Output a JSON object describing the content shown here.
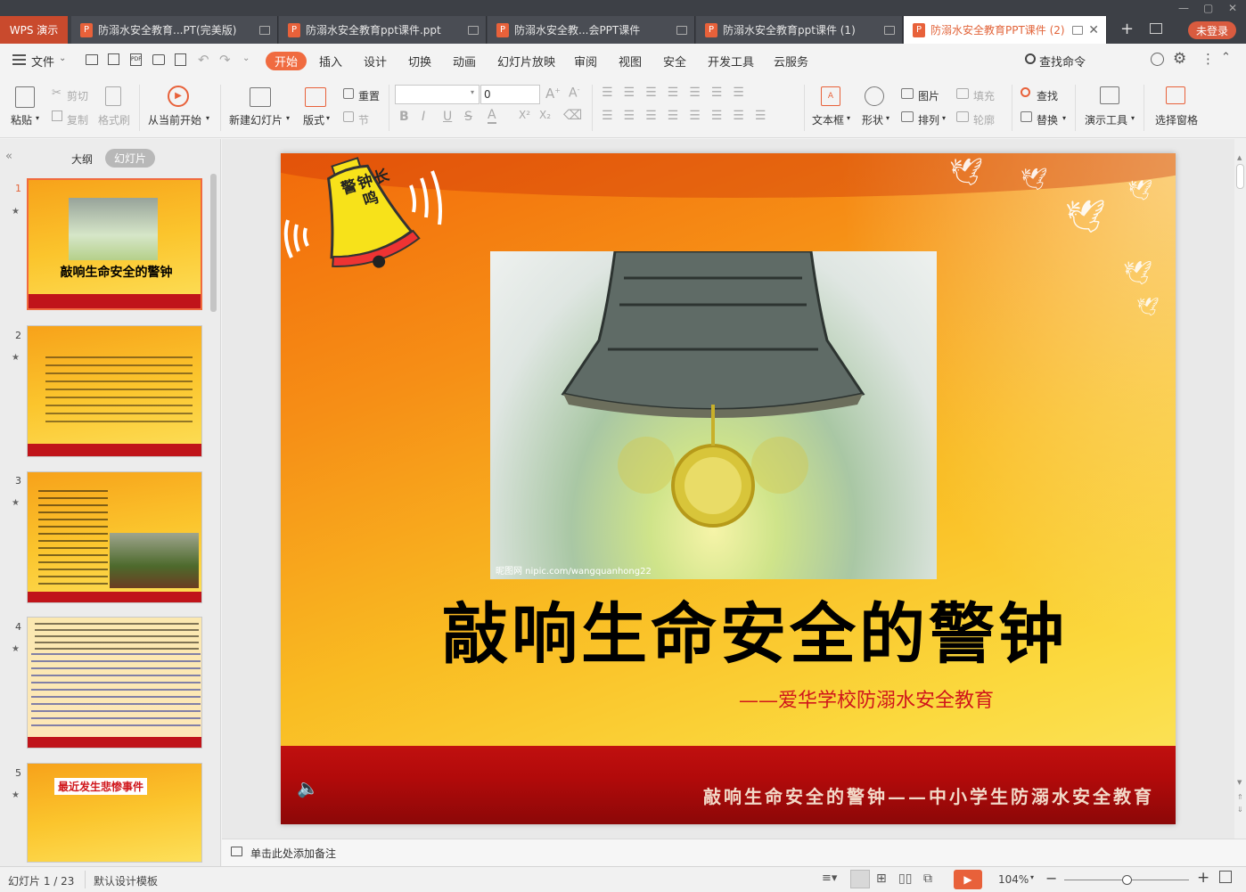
{
  "app": {
    "name": "WPS 演示",
    "login": "未登录"
  },
  "tabs": [
    {
      "label": "防溺水安全教育...PT(完美版)",
      "active": false
    },
    {
      "label": "防溺水安全教育ppt课件.ppt",
      "active": false
    },
    {
      "label": "防溺水安全教...会PPT课件",
      "active": false
    },
    {
      "label": "防溺水安全教育ppt课件 (1)",
      "active": false
    },
    {
      "label": "防溺水安全教育PPT课件 (2)",
      "active": true
    }
  ],
  "menu": {
    "file": "文件",
    "items": [
      "开始",
      "插入",
      "设计",
      "切换",
      "动画",
      "幻灯片放映",
      "审阅",
      "视图",
      "安全",
      "开发工具",
      "云服务"
    ],
    "search": "查找命令"
  },
  "toolbar": {
    "paste": "粘贴",
    "cut": "剪切",
    "copy": "复制",
    "format_painter": "格式刷",
    "from_current": "从当前开始",
    "new_slide": "新建幻灯片",
    "layout": "版式",
    "reset": "重置",
    "section": "节",
    "font_size": "0",
    "textbox": "文本框",
    "shapes": "形状",
    "picture": "图片",
    "arrange": "排列",
    "fill": "填充",
    "outline": "轮廓",
    "find": "查找",
    "replace": "替换",
    "present_tools": "演示工具",
    "select_pane": "选择窗格",
    "bold": "B",
    "italic": "I",
    "underline": "U",
    "strike": "S",
    "fontcolor": "A"
  },
  "left_panel": {
    "outline_tab": "大纲",
    "slides_tab": "幻灯片"
  },
  "thumbnails": [
    {
      "num": "1",
      "title": "敲响生命安全的警钟"
    },
    {
      "num": "2"
    },
    {
      "num": "3",
      "text": "周末的阳光照耀着..."
    },
    {
      "num": "4",
      "text": "溺水，是广大少年儿童意外伤害致死的第一杀手..."
    },
    {
      "num": "5",
      "title": "最近发生悲惨事件"
    }
  ],
  "slide": {
    "bell_text": "警钟长鸣",
    "watermark": "昵图网 nipic.com/wangquanhong22",
    "title": "敲响生命安全的警钟",
    "subtitle": "——爱华学校防溺水安全教育",
    "footer": "敲响生命安全的警钟——中小学生防溺水安全教育"
  },
  "notes_placeholder": "单击此处添加备注",
  "status": {
    "slide_pos": "幻灯片 1 / 23",
    "template": "默认设计模板",
    "zoom": "104%"
  },
  "colors": {
    "accent": "#f06b40",
    "titlebar": "#3d4046",
    "slide_title": "#000000",
    "subtitle": "#d0161b"
  }
}
